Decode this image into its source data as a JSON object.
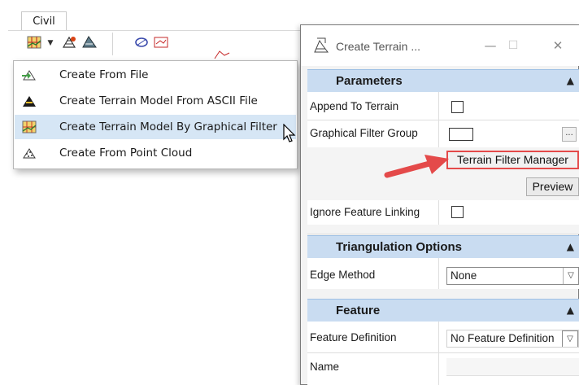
{
  "ribbon": {
    "tab_label": "Civil"
  },
  "menu": {
    "items": [
      {
        "label": "Create From File",
        "icon": "import-terrain-icon"
      },
      {
        "label": "Create Terrain Model From ASCII File",
        "icon": "ascii-terrain-icon"
      },
      {
        "label": "Create Terrain Model By Graphical Filter",
        "icon": "graphical-filter-terrain-icon",
        "highlighted": true
      },
      {
        "label": "Create From Point Cloud",
        "icon": "point-cloud-terrain-icon"
      }
    ]
  },
  "dialog": {
    "title": "Create Terrain ...",
    "minimize": "—",
    "maximize": "☐",
    "close": "✕",
    "sections": {
      "parameters": {
        "title": "Parameters",
        "append_label": "Append To Terrain",
        "filter_group_label": "Graphical Filter Group",
        "browse_label": "...",
        "filter_manager_button": "Terrain Filter Manager",
        "preview_button": "Preview",
        "ignore_label": "Ignore Feature Linking"
      },
      "triangulation": {
        "title": "Triangulation Options",
        "edge_method_label": "Edge Method",
        "edge_method_value": "None"
      },
      "feature": {
        "title": "Feature",
        "feature_def_label": "Feature Definition",
        "feature_def_value": "No Feature Definition",
        "name_label": "Name"
      }
    }
  },
  "colors": {
    "highlight": "#d6e6f5",
    "section": "#c9dcf1",
    "annotation_arrow": "#e44a4a"
  }
}
